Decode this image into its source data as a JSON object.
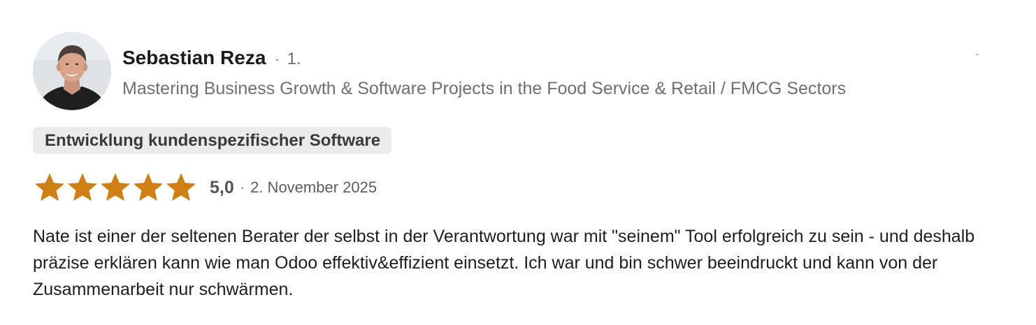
{
  "review": {
    "author": {
      "name": "Sebastian Reza",
      "separator": "·",
      "degree": "1.",
      "headline": "Mastering Business Growth & Software Projects in the Food Service & Retail / FMCG Sectors",
      "avatar_icon": "person-portrait-avatar"
    },
    "service_tag": "Entwicklung kundenspezifischer Software",
    "rating": {
      "stars": 5,
      "max_stars": 5,
      "star_icon": "star-filled-icon",
      "star_color": "#cf7f14",
      "value": "5,0",
      "separator": "·",
      "date": "2. November 2025"
    },
    "text": "Nate ist einer der seltenen Berater der selbst in der Verantwortung war mit \"seinem\" Tool erfolgreich zu sein - und deshalb präzise erklären kann wie man Odoo effektiv&effizient einsetzt. Ich war und bin schwer beeindruckt und kann von der Zusammenarbeit nur schwärmen."
  }
}
